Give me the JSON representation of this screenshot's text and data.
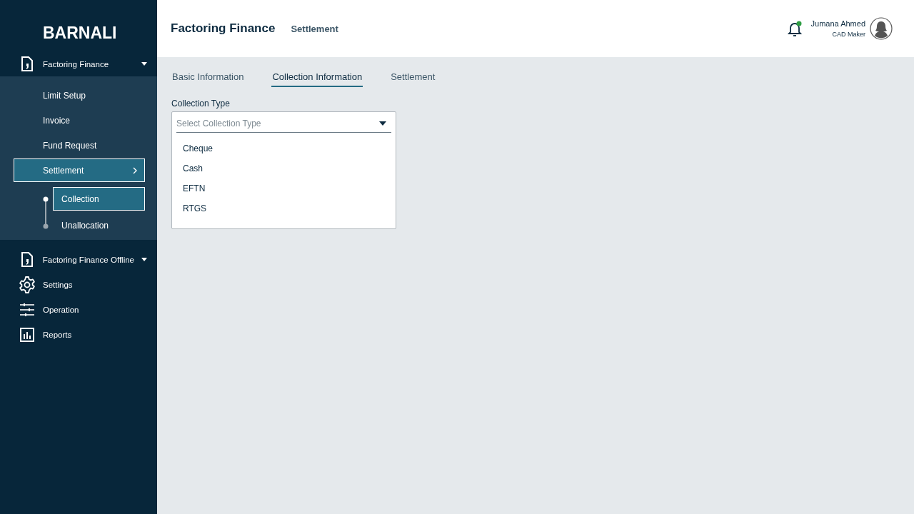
{
  "sidebar": {
    "brand": "BARNALI",
    "menu": [
      {
        "label": "Factoring Finance",
        "kind": "group",
        "expanded": true,
        "children": [
          {
            "label": "Limit Setup",
            "selected": false
          },
          {
            "label": "Invoice",
            "selected": false
          },
          {
            "label": "Fund Request",
            "selected": false
          },
          {
            "label": "Settlement",
            "selected": true,
            "children": [
              {
                "label": "Collection",
                "selected": true
              },
              {
                "label": "Unallocation",
                "selected": false
              }
            ]
          }
        ]
      },
      {
        "label": "Factoring Finance Offline",
        "kind": "group",
        "expanded": false
      },
      {
        "label": "Settings",
        "kind": "link"
      },
      {
        "label": "Operation",
        "kind": "link"
      },
      {
        "label": "Reports",
        "kind": "link"
      }
    ]
  },
  "header": {
    "title": "Factoring Finance",
    "subtitle": "Settlement",
    "notification": {
      "unread": true
    },
    "user": {
      "name": "Jumana Ahmed",
      "role": "CAD Maker"
    }
  },
  "tabs": [
    {
      "label": "Basic Information",
      "selected": false
    },
    {
      "label": "Collection Information",
      "selected": true
    },
    {
      "label": "Settlement",
      "selected": false
    }
  ],
  "form": {
    "label": "Collection Type",
    "placeholder": "Select Collection Type",
    "open": true,
    "options": [
      {
        "label": "Cheque",
        "selected": false
      },
      {
        "label": "Cash",
        "selected": false
      },
      {
        "label": "EFTN",
        "selected": false
      },
      {
        "label": "RTGS",
        "selected": false
      }
    ]
  }
}
